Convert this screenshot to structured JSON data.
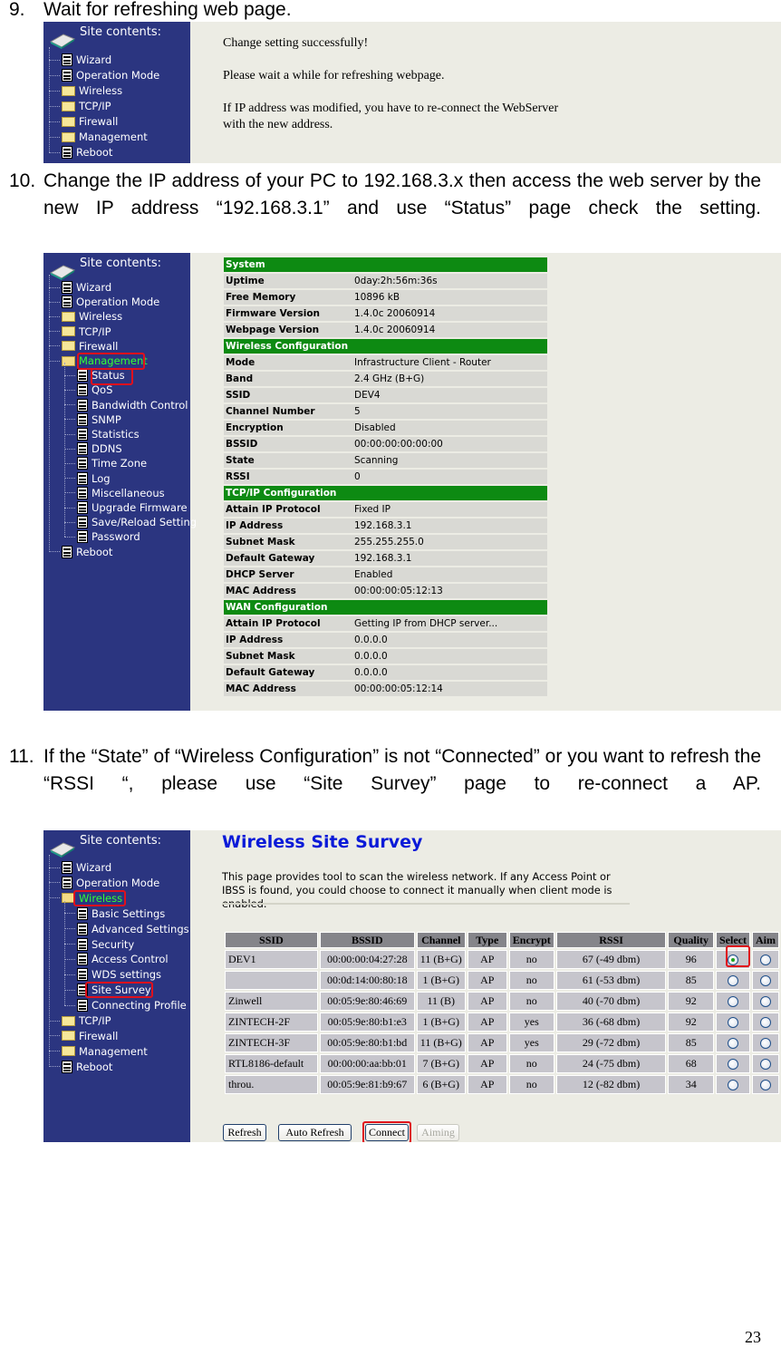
{
  "steps": [
    {
      "number": "9.",
      "text": "Wait for refreshing web page."
    },
    {
      "number": "10.",
      "text": "Change the IP address of your PC to 192.168.3.x then access the web server by the new IP address “192.168.3.1” and use “Status” page check the setting."
    },
    {
      "number": "11.",
      "text": "If the “State” of “Wireless Configuration” is not “Connected” or you want to refresh the “RSSI “, please use “Site Survey” page to re-connect a AP."
    }
  ],
  "sidebar_title": "Site contents:",
  "screenshot1": {
    "menu": [
      {
        "label": "Wizard",
        "icon": "page-icon"
      },
      {
        "label": "Operation Mode",
        "icon": "page-icon"
      },
      {
        "label": "Wireless",
        "icon": "folder-icon"
      },
      {
        "label": "TCP/IP",
        "icon": "folder-icon"
      },
      {
        "label": "Firewall",
        "icon": "folder-icon"
      },
      {
        "label": "Management",
        "icon": "folder-icon"
      },
      {
        "label": "Reboot",
        "icon": "page-icon"
      }
    ],
    "messages": [
      "Change setting successfully!",
      "Please wait a while for refreshing webpage.",
      "If IP address was modified, you have to re-connect the WebServer",
      "with the new address."
    ]
  },
  "screenshot2": {
    "menu": [
      {
        "label": "Wizard",
        "icon": "page-icon",
        "level": 0
      },
      {
        "label": "Operation Mode",
        "icon": "page-icon",
        "level": 0
      },
      {
        "label": "Wireless",
        "icon": "folder-icon",
        "level": 0
      },
      {
        "label": "TCP/IP",
        "icon": "folder-icon",
        "level": 0
      },
      {
        "label": "Firewall",
        "icon": "folder-icon",
        "level": 0
      },
      {
        "label": "Management",
        "icon": "folder-open-icon",
        "level": 0,
        "active": true
      },
      {
        "label": "Status",
        "icon": "page-icon",
        "level": 1
      },
      {
        "label": "QoS",
        "icon": "page-icon",
        "level": 1
      },
      {
        "label": "Bandwidth Control",
        "icon": "page-icon",
        "level": 1
      },
      {
        "label": "SNMP",
        "icon": "page-icon",
        "level": 1
      },
      {
        "label": "Statistics",
        "icon": "page-icon",
        "level": 1
      },
      {
        "label": "DDNS",
        "icon": "page-icon",
        "level": 1
      },
      {
        "label": "Time Zone",
        "icon": "page-icon",
        "level": 1
      },
      {
        "label": "Log",
        "icon": "page-icon",
        "level": 1
      },
      {
        "label": "Miscellaneous",
        "icon": "page-icon",
        "level": 1
      },
      {
        "label": "Upgrade Firmware",
        "icon": "page-icon",
        "level": 1
      },
      {
        "label": "Save/Reload Setting",
        "icon": "page-icon",
        "level": 1
      },
      {
        "label": "Password",
        "icon": "page-icon",
        "level": 1
      },
      {
        "label": "Reboot",
        "icon": "page-icon",
        "level": 0
      }
    ],
    "status": [
      {
        "section": "System",
        "rows": [
          [
            "Uptime",
            "0day:2h:56m:36s"
          ],
          [
            "Free Memory",
            "10896 kB"
          ],
          [
            "Firmware Version",
            "1.4.0c 20060914"
          ],
          [
            "Webpage Version",
            "1.4.0c 20060914"
          ]
        ]
      },
      {
        "section": "Wireless Configuration",
        "rows": [
          [
            "Mode",
            "Infrastructure Client - Router"
          ],
          [
            "Band",
            "2.4 GHz (B+G)"
          ],
          [
            "SSID",
            "DEV4"
          ],
          [
            "Channel Number",
            "5"
          ],
          [
            "Encryption",
            "Disabled"
          ],
          [
            "BSSID",
            "00:00:00:00:00:00"
          ],
          [
            "State",
            "Scanning"
          ],
          [
            "RSSI",
            "0"
          ]
        ]
      },
      {
        "section": "TCP/IP Configuration",
        "rows": [
          [
            "Attain IP Protocol",
            "Fixed IP"
          ],
          [
            "IP Address",
            "192.168.3.1"
          ],
          [
            "Subnet Mask",
            "255.255.255.0"
          ],
          [
            "Default Gateway",
            "192.168.3.1"
          ],
          [
            "DHCP Server",
            "Enabled"
          ],
          [
            "MAC Address",
            "00:00:00:05:12:13"
          ]
        ]
      },
      {
        "section": "WAN Configuration",
        "rows": [
          [
            "Attain IP Protocol",
            "Getting IP from DHCP server..."
          ],
          [
            "IP Address",
            "0.0.0.0"
          ],
          [
            "Subnet Mask",
            "0.0.0.0"
          ],
          [
            "Default Gateway",
            "0.0.0.0"
          ],
          [
            "MAC Address",
            "00:00:00:05:12:14"
          ]
        ]
      }
    ]
  },
  "screenshot3": {
    "menu": [
      {
        "label": "Wizard",
        "icon": "page-icon",
        "level": 0
      },
      {
        "label": "Operation Mode",
        "icon": "page-icon",
        "level": 0
      },
      {
        "label": "Wireless",
        "icon": "folder-open-icon",
        "level": 0,
        "active": true
      },
      {
        "label": "Basic Settings",
        "icon": "page-icon",
        "level": 1
      },
      {
        "label": "Advanced Settings",
        "icon": "page-icon",
        "level": 1
      },
      {
        "label": "Security",
        "icon": "page-icon",
        "level": 1
      },
      {
        "label": "Access Control",
        "icon": "page-icon",
        "level": 1
      },
      {
        "label": "WDS settings",
        "icon": "page-icon",
        "level": 1
      },
      {
        "label": "Site Survey",
        "icon": "page-icon",
        "level": 1
      },
      {
        "label": "Connecting Profile",
        "icon": "page-icon",
        "level": 1
      },
      {
        "label": "TCP/IP",
        "icon": "folder-icon",
        "level": 0
      },
      {
        "label": "Firewall",
        "icon": "folder-icon",
        "level": 0
      },
      {
        "label": "Management",
        "icon": "folder-icon",
        "level": 0
      },
      {
        "label": "Reboot",
        "icon": "page-icon",
        "level": 0
      }
    ],
    "title": "Wireless Site Survey",
    "description": "This page provides tool to scan the wireless network. If any Access Point or IBSS is found, you could choose to connect it manually when client mode is enabled.",
    "columns": [
      "SSID",
      "BSSID",
      "Channel",
      "Type",
      "Encrypt",
      "RSSI",
      "Quality",
      "Select",
      "Aim"
    ],
    "rows": [
      {
        "ssid": "DEV1",
        "bssid": "00:00:00:04:27:28",
        "channel": "11 (B+G)",
        "type": "AP",
        "encrypt": "no",
        "rssi": "67 (-49 dbm)",
        "quality": "96",
        "selected": true
      },
      {
        "ssid": "",
        "bssid": "00:0d:14:00:80:18",
        "channel": "1 (B+G)",
        "type": "AP",
        "encrypt": "no",
        "rssi": "61 (-53 dbm)",
        "quality": "85",
        "selected": false
      },
      {
        "ssid": "Zinwell",
        "bssid": "00:05:9e:80:46:69",
        "channel": "11 (B)",
        "type": "AP",
        "encrypt": "no",
        "rssi": "40 (-70 dbm)",
        "quality": "92",
        "selected": false
      },
      {
        "ssid": "ZINTECH-2F",
        "bssid": "00:05:9e:80:b1:e3",
        "channel": "1 (B+G)",
        "type": "AP",
        "encrypt": "yes",
        "rssi": "36 (-68 dbm)",
        "quality": "92",
        "selected": false
      },
      {
        "ssid": "ZINTECH-3F",
        "bssid": "00:05:9e:80:b1:bd",
        "channel": "11 (B+G)",
        "type": "AP",
        "encrypt": "yes",
        "rssi": "29 (-72 dbm)",
        "quality": "85",
        "selected": false
      },
      {
        "ssid": "RTL8186-default",
        "bssid": "00:00:00:aa:bb:01",
        "channel": "7 (B+G)",
        "type": "AP",
        "encrypt": "no",
        "rssi": "24 (-75 dbm)",
        "quality": "68",
        "selected": false
      },
      {
        "ssid": "throu.",
        "bssid": "00:05:9e:81:b9:67",
        "channel": "6 (B+G)",
        "type": "AP",
        "encrypt": "no",
        "rssi": "12 (-82 dbm)",
        "quality": "34",
        "selected": false
      }
    ],
    "buttons": {
      "refresh": "Refresh",
      "auto_refresh": "Auto Refresh",
      "connect": "Connect",
      "aiming": "Aiming"
    }
  },
  "page_number": "23"
}
